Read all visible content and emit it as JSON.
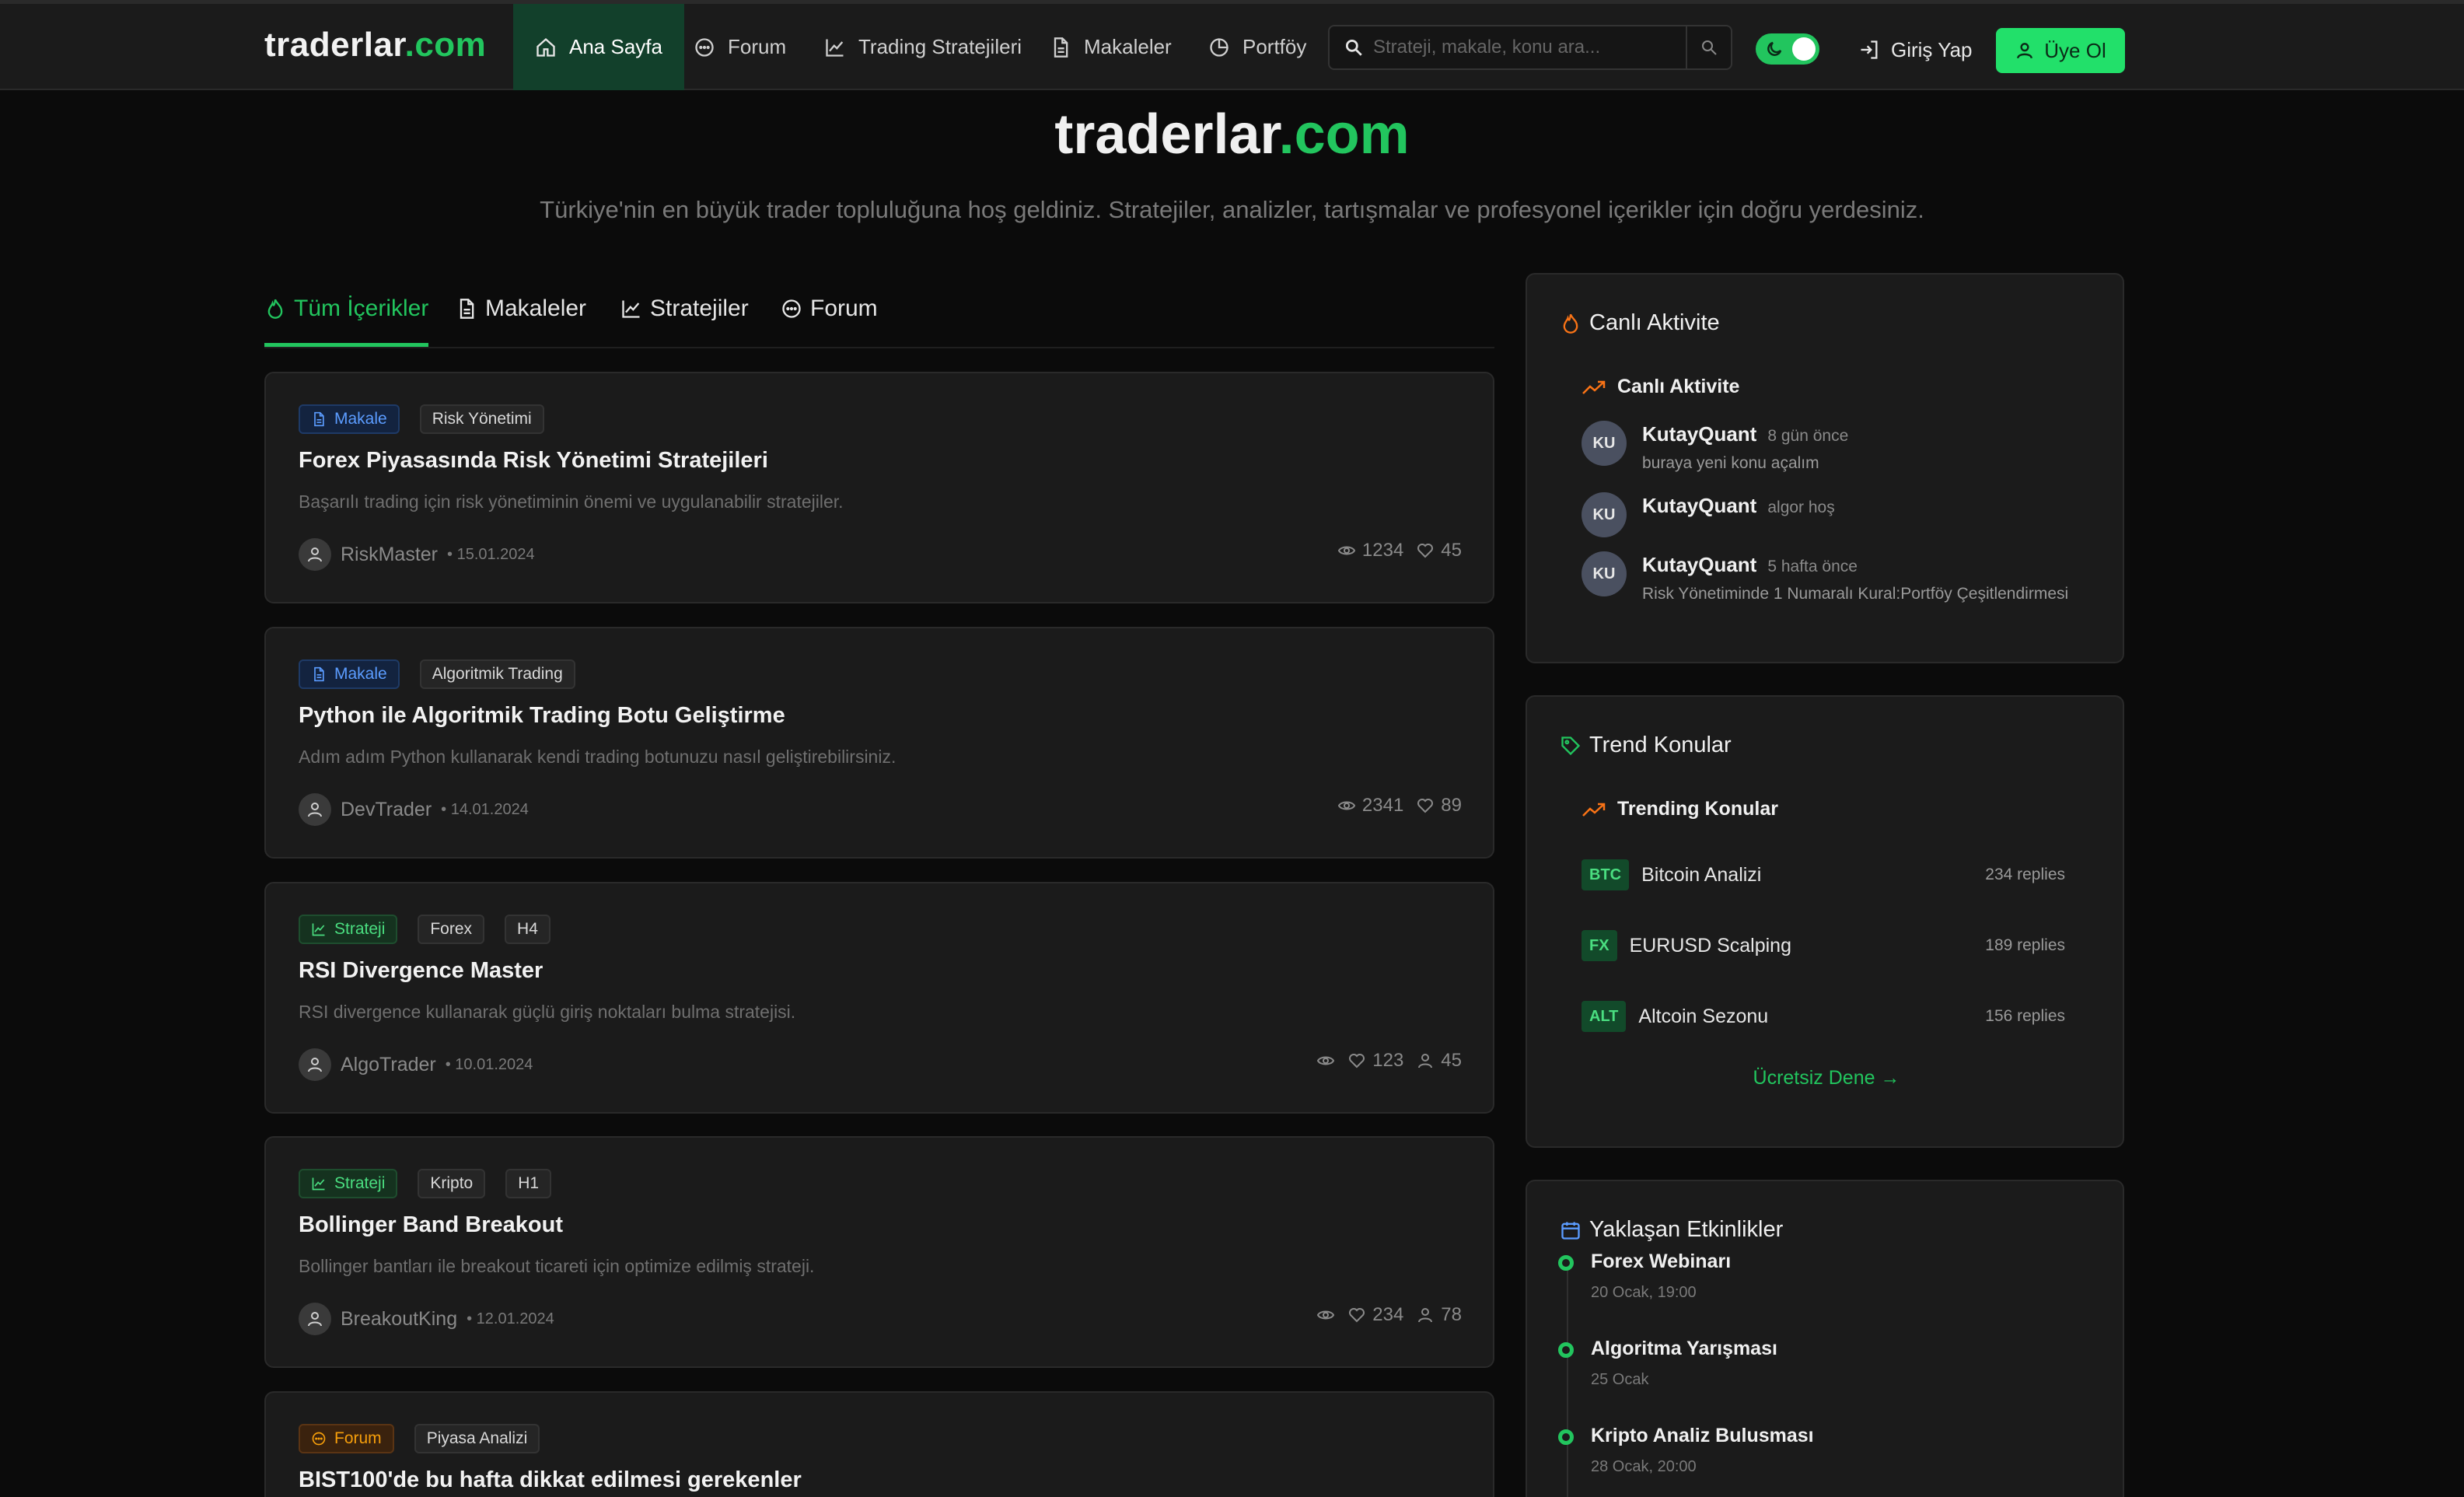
{
  "brand": {
    "name_main": "traderlar",
    "name_tld": ".com"
  },
  "nav": {
    "items": [
      {
        "label": "Ana Sayfa",
        "icon": "home-icon",
        "active": true
      },
      {
        "label": "Forum",
        "icon": "chat-icon"
      },
      {
        "label": "Trading Stratejileri",
        "icon": "chart-line-icon"
      },
      {
        "label": "Makaleler",
        "icon": "document-icon"
      },
      {
        "label": "Portföy",
        "icon": "pie-chart-icon"
      }
    ],
    "search_placeholder": "Strateji, makale, konu ara...",
    "login_label": "Giriş Yap",
    "signup_label": "Üye Ol"
  },
  "hero": {
    "title_main": "traderlar",
    "title_tld": ".com",
    "subtitle": "Türkiye'nin en büyük trader topluluğuna hoş geldiniz. Stratejiler, analizler, tartışmalar ve profesyonel içerikler için doğru yerdesiniz."
  },
  "tabs": [
    {
      "label": "Tüm İçerikler",
      "icon": "flame-icon",
      "active": true
    },
    {
      "label": "Makaleler",
      "icon": "document-icon"
    },
    {
      "label": "Stratejiler",
      "icon": "chart-line-icon"
    },
    {
      "label": "Forum",
      "icon": "chat-icon"
    }
  ],
  "cards": [
    {
      "type": "Makale",
      "tags": [
        "Risk Yönetimi"
      ],
      "title": "Forex Piyasasında Risk Yönetimi Stratejileri",
      "desc": "Başarılı trading için risk yönetiminin önemi ve uygulanabilir stratejiler.",
      "author": "RiskMaster",
      "date": "• 15.01.2024",
      "views": "1234",
      "likes": "45"
    },
    {
      "type": "Makale",
      "tags": [
        "Algoritmik Trading"
      ],
      "title": "Python ile Algoritmik Trading Botu Geliştirme",
      "desc": "Adım adım Python kullanarak kendi trading botunuzu nasıl geliştirebilirsiniz.",
      "author": "DevTrader",
      "date": "• 14.01.2024",
      "views": "2341",
      "likes": "89"
    },
    {
      "type": "Strateji",
      "tags": [
        "Forex",
        "H4"
      ],
      "title": "RSI Divergence Master",
      "desc": "RSI divergence kullanarak güçlü giriş noktaları bulma stratejisi.",
      "author": "AlgoTrader",
      "date": "• 10.01.2024",
      "likes": "123",
      "users": "45"
    },
    {
      "type": "Strateji",
      "tags": [
        "Kripto",
        "H1"
      ],
      "title": "Bollinger Band Breakout",
      "desc": "Bollinger bantları ile breakout ticareti için optimize edilmiş strateji.",
      "author": "BreakoutKing",
      "date": "• 12.01.2024",
      "likes": "234",
      "users": "78"
    },
    {
      "type": "Forum",
      "tags": [
        "Piyasa Analizi"
      ],
      "title": "BIST100'de bu hafta dikkat edilmesi gerekenler"
    }
  ],
  "live_activity": {
    "title": "Canlı Aktivite",
    "subtitle": "Canlı Aktivite",
    "items": [
      {
        "initials": "KU",
        "name": "KutayQuant",
        "meta": "8 gün önce",
        "text": "buraya yeni konu açalım"
      },
      {
        "initials": "KU",
        "name": "KutayQuant",
        "meta": "algor hoş",
        "text": ""
      },
      {
        "initials": "KU",
        "name": "KutayQuant",
        "meta": "5 hafta önce",
        "text": "Risk Yönetiminde 1 Numaralı Kural:Portföy Çeşitlendirmesi"
      }
    ]
  },
  "trending": {
    "title": "Trend Konular",
    "subtitle": "Trending Konular",
    "items": [
      {
        "code": "BTC",
        "name": "Bitcoin Analizi",
        "replies": "234 replies"
      },
      {
        "code": "FX",
        "name": "EURUSD Scalping",
        "replies": "189 replies"
      },
      {
        "code": "ALT",
        "name": "Altcoin Sezonu",
        "replies": "156 replies"
      }
    ],
    "cta": "Ücretsiz Dene →"
  },
  "events": {
    "title": "Yaklaşan Etkinlikler",
    "items": [
      {
        "name": "Forex Webinarı",
        "date": "20 Ocak, 19:00"
      },
      {
        "name": "Algoritma Yarışması",
        "date": "25 Ocak"
      },
      {
        "name": "Kripto Analiz Bulusması",
        "date": "28 Ocak, 20:00"
      }
    ]
  },
  "colors": {
    "accent": "#22c55e",
    "background": "#0b0b0b",
    "card": "#1b1b1b",
    "article_badge": "#5b9cff",
    "strategy_badge": "#4ade80",
    "forum_badge": "#f59e0b"
  }
}
